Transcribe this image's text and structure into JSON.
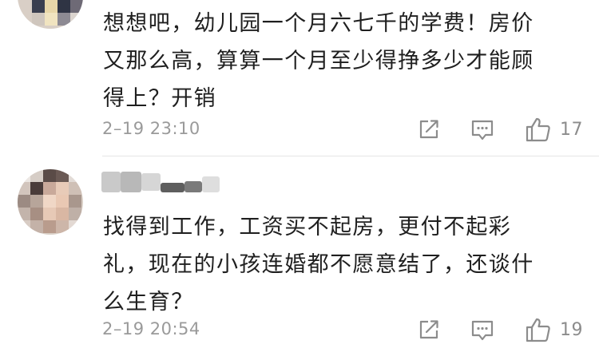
{
  "comments": [
    {
      "text": "想想吧，幼儿园一个月六七千的学费！房价\n又那么高，算算一个月至少得挣多少才能顾\n得上？开销",
      "timestamp": "2–19 23:10",
      "likes": "17",
      "icons": {
        "share": "share-square-icon",
        "reply": "comment-bubble-icon",
        "like": "thumbs-up-icon"
      }
    },
    {
      "text": "找得到工作，工资买不起房，更付不起彩\n礼，现在的小孩连婚都不愿意结了，还谈什\n么生育？",
      "timestamp": "2–19 20:54",
      "likes": "19",
      "icons": {
        "share": "share-square-icon",
        "reply": "comment-bubble-icon",
        "like": "thumbs-up-icon"
      }
    }
  ],
  "colors": {
    "text": "#1f1f1f",
    "meta": "#9a9a9a",
    "icon": "#8c8c8c",
    "divider": "#e6e6e6"
  }
}
